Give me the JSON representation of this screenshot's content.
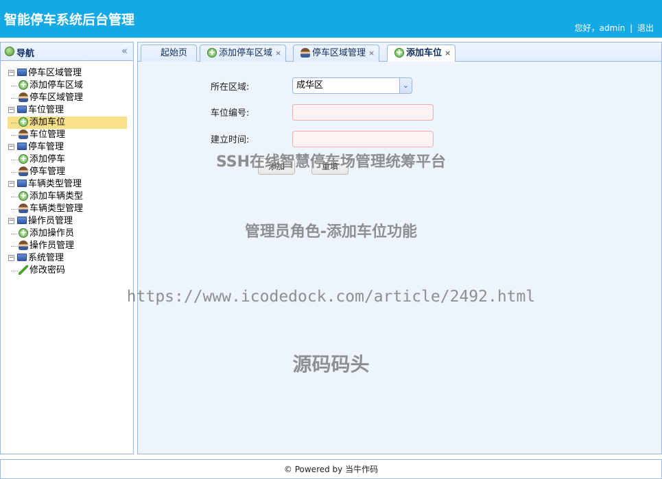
{
  "header": {
    "title": "智能停车系统后台管理",
    "greeting": "您好，admin",
    "separator": "|",
    "logout": "退出"
  },
  "nav": {
    "title": "导航",
    "collapse_icon": "double-chevron-left-icon",
    "groups": [
      {
        "label": "停车区域管理",
        "icon": "computer-icon",
        "children": [
          {
            "label": "添加停车区域",
            "icon": "add-icon"
          },
          {
            "label": "停车区域管理",
            "icon": "user-icon"
          }
        ]
      },
      {
        "label": "车位管理",
        "icon": "computer-icon",
        "children": [
          {
            "label": "添加车位",
            "icon": "add-icon",
            "selected": true
          },
          {
            "label": "车位管理",
            "icon": "user-icon"
          }
        ]
      },
      {
        "label": "停车管理",
        "icon": "computer-icon",
        "children": [
          {
            "label": "添加停车",
            "icon": "add-icon"
          },
          {
            "label": "停车管理",
            "icon": "user-icon"
          }
        ]
      },
      {
        "label": "车辆类型管理",
        "icon": "computer-icon",
        "children": [
          {
            "label": "添加车辆类型",
            "icon": "add-icon"
          },
          {
            "label": "车辆类型管理",
            "icon": "user-icon"
          }
        ]
      },
      {
        "label": "操作员管理",
        "icon": "computer-icon",
        "children": [
          {
            "label": "添加操作员",
            "icon": "add-icon"
          },
          {
            "label": "操作员管理",
            "icon": "user-icon"
          }
        ]
      },
      {
        "label": "系统管理",
        "icon": "computer-icon",
        "children": [
          {
            "label": "修改密码",
            "icon": "pencil-icon"
          }
        ]
      }
    ]
  },
  "tabs": [
    {
      "label": "起始页",
      "closable": false
    },
    {
      "label": "添加停车区域",
      "closable": true,
      "icon": "add-icon"
    },
    {
      "label": "停车区域管理",
      "closable": true,
      "icon": "user-icon"
    },
    {
      "label": "添加车位",
      "closable": true,
      "icon": "add-icon",
      "active": true
    }
  ],
  "form": {
    "area_label": "所在区域:",
    "area_value": "成华区",
    "number_label": "车位编号:",
    "number_value": "",
    "time_label": "建立时间:",
    "time_value": "",
    "add_button": "添加",
    "reset_button": "重填"
  },
  "watermarks": {
    "line1": "SSH在线智慧停车场管理统筹平台",
    "line2": "管理员角色-添加车位功能",
    "line3": "https://www.icodedock.com/article/2492.html",
    "line4": "源码码头"
  },
  "footer": {
    "text": "© Powered by 当牛作码"
  },
  "colors": {
    "header_bg": "#14a9e4",
    "panel_border": "#95b8e7",
    "selected_bg": "#fbe08a",
    "invalid_border": "#ffa8a8"
  }
}
